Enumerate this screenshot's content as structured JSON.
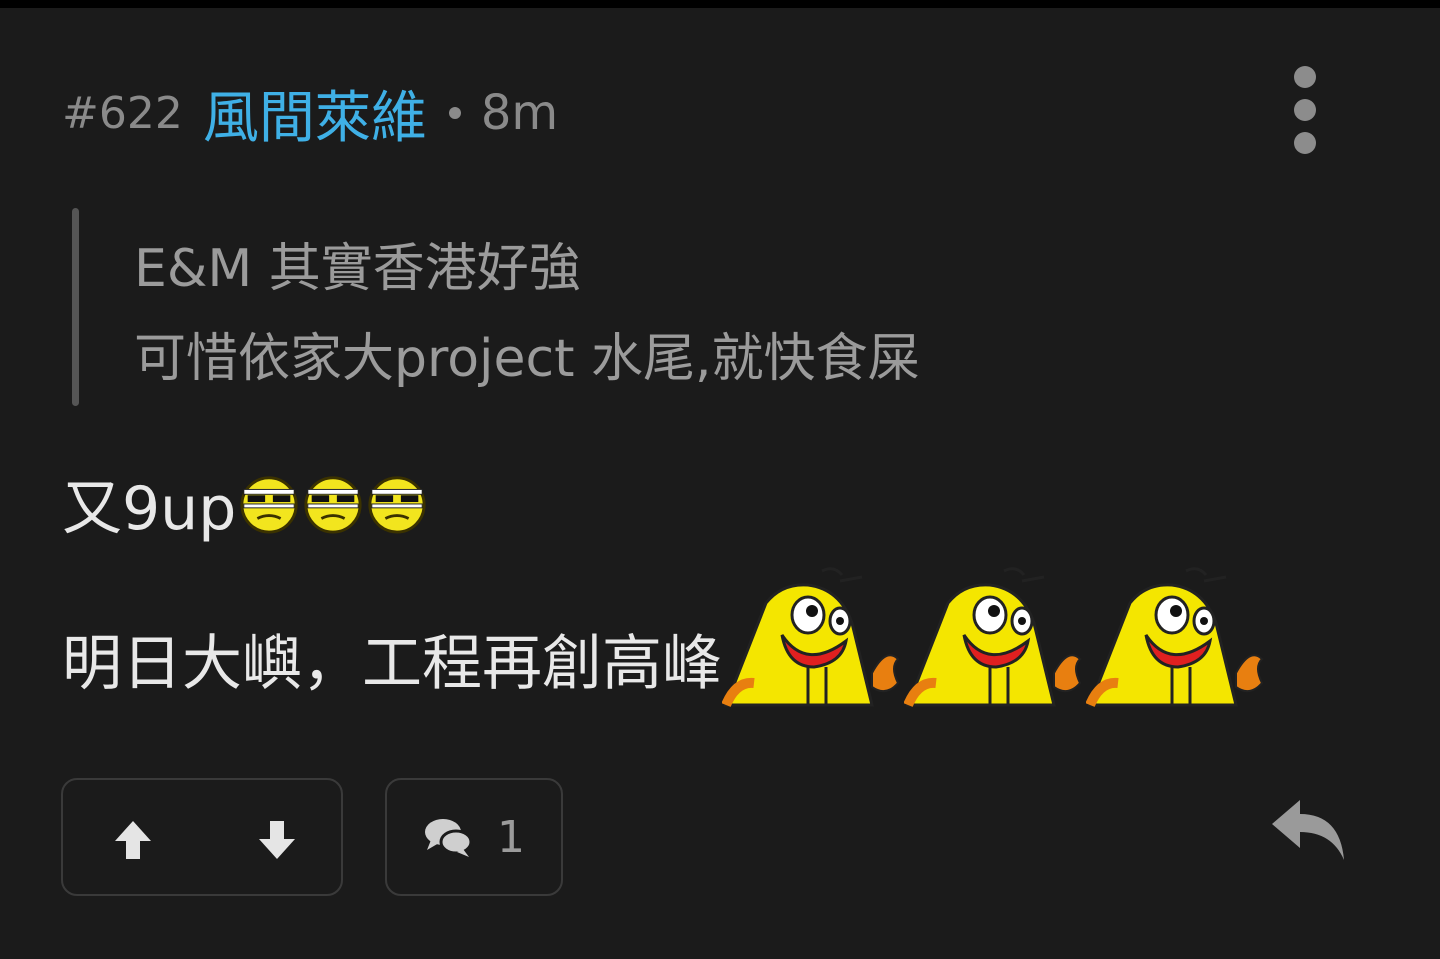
{
  "post": {
    "number": "#622",
    "username": "風間萊維",
    "time": "8m",
    "quote": {
      "line1": "E&M 其實香港好強",
      "line2": "可惜依家大project 水尾,就快食屎"
    },
    "body": {
      "line1_text": "又9up",
      "line2_text": "明日大嶼，工程再創高峰"
    },
    "emojis": {
      "line1": [
        "sunglasses-face-emoji",
        "sunglasses-face-emoji",
        "sunglasses-face-emoji"
      ],
      "line2": [
        "yellow-chick-emoji",
        "yellow-chick-emoji",
        "yellow-chick-emoji"
      ]
    },
    "actions": {
      "comment_count": "1"
    }
  },
  "colors": {
    "background": "#1b1b1b",
    "username": "#3fb0e6",
    "muted_text": "#8a8a8a",
    "body_text": "#e8e8e8",
    "quote_text": "#9b9b9b",
    "button_border": "#3a3a3a"
  }
}
